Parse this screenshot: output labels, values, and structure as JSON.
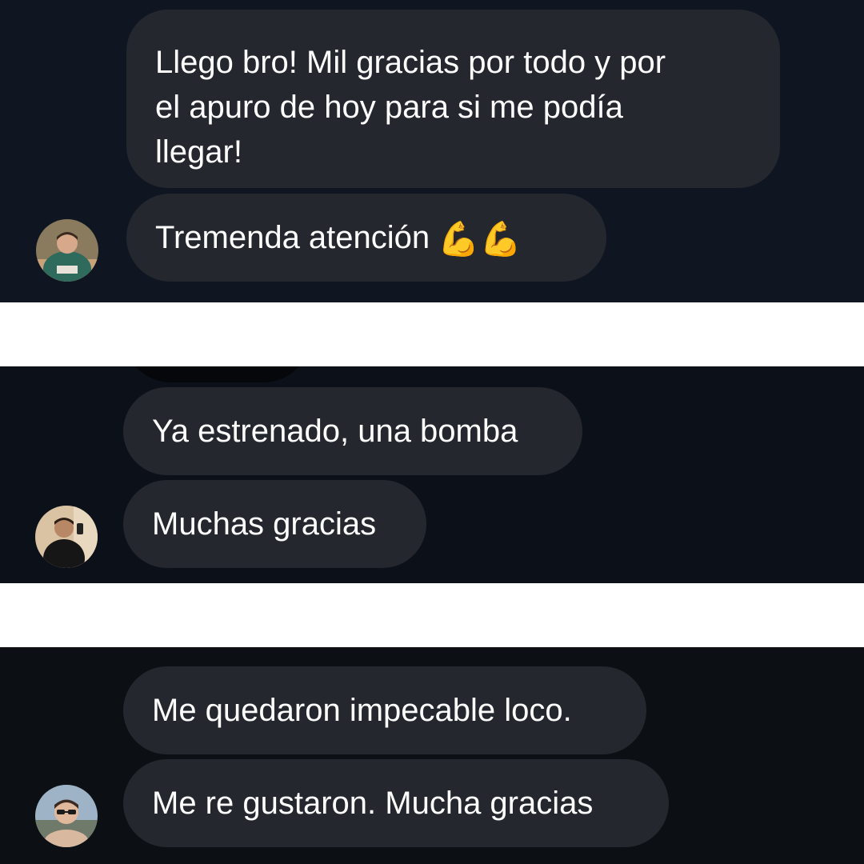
{
  "groups": [
    {
      "messages": [
        {
          "lines": [
            "Llego bro! Mil gracias por todo y por",
            "el apuro de hoy para si me podía",
            "llegar!"
          ]
        },
        {
          "text": "Tremenda atención",
          "emoji": "💪💪"
        }
      ],
      "avatar": {
        "icon": "user-avatar-icon",
        "tone": "green-sweater"
      }
    },
    {
      "messages": [
        {
          "text": "Ya estrenado, una bomba"
        },
        {
          "text": "Muchas gracias"
        }
      ],
      "avatar": {
        "icon": "user-avatar-icon",
        "tone": "black-tshirt"
      }
    },
    {
      "messages": [
        {
          "text": "Me quedaron impecable loco."
        },
        {
          "text": "Me re gustaron. Mucha gracias"
        }
      ],
      "avatar": {
        "icon": "user-avatar-icon",
        "tone": "sunglasses"
      }
    }
  ],
  "colors": {
    "bubble": "#25272f",
    "text": "#ffffff",
    "separator": "#ffffff",
    "panel_bg": "#0f1621"
  }
}
